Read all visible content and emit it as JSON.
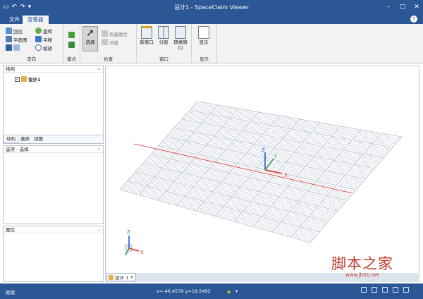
{
  "title_bar": {
    "title": "设计1 - SpaceClaim Viewer",
    "quick_access": [
      "folder-icon",
      "undo-icon",
      "redo-icon",
      "dropdown-icon"
    ],
    "window_controls": [
      "minimize-icon",
      "restore-icon",
      "close-icon"
    ]
  },
  "ribbon": {
    "tabs": [
      {
        "label": "文件",
        "active": false
      },
      {
        "label": "查看器",
        "active": true
      }
    ],
    "groups": {
      "orient": {
        "label": "定向",
        "items": [
          "回位",
          "旋转",
          "平面图",
          "平移",
          "缩放"
        ]
      },
      "mode": {
        "label": "模式"
      },
      "inspect": {
        "label": "检查",
        "select_label": "选择",
        "mass_props": "质量属性",
        "measure": "测量"
      },
      "window": {
        "label": "窗口",
        "new_window": "新窗口",
        "split": "分割",
        "switch_window": "转换窗口"
      },
      "display": {
        "label": "显示",
        "button": "显示"
      }
    }
  },
  "structure_panel": {
    "title": "结构",
    "tree_item": "设计1",
    "tabs": [
      "结构",
      "选择",
      "视图"
    ]
  },
  "options_panel": {
    "title": "选项 - 选择"
  },
  "properties_panel": {
    "title": "属性"
  },
  "viewport": {
    "axis_x": "X",
    "axis_y": "Y",
    "axis_z": "Z",
    "doc_tab": "设计 1",
    "grid_color": "#b3bccb",
    "x_axis_color": "#e03030"
  },
  "status_bar": {
    "status": "就绪",
    "coords": "x=-46.4579  y=19.5492"
  },
  "watermark": {
    "text": "脚本之家",
    "url": "www.jb51.net"
  }
}
